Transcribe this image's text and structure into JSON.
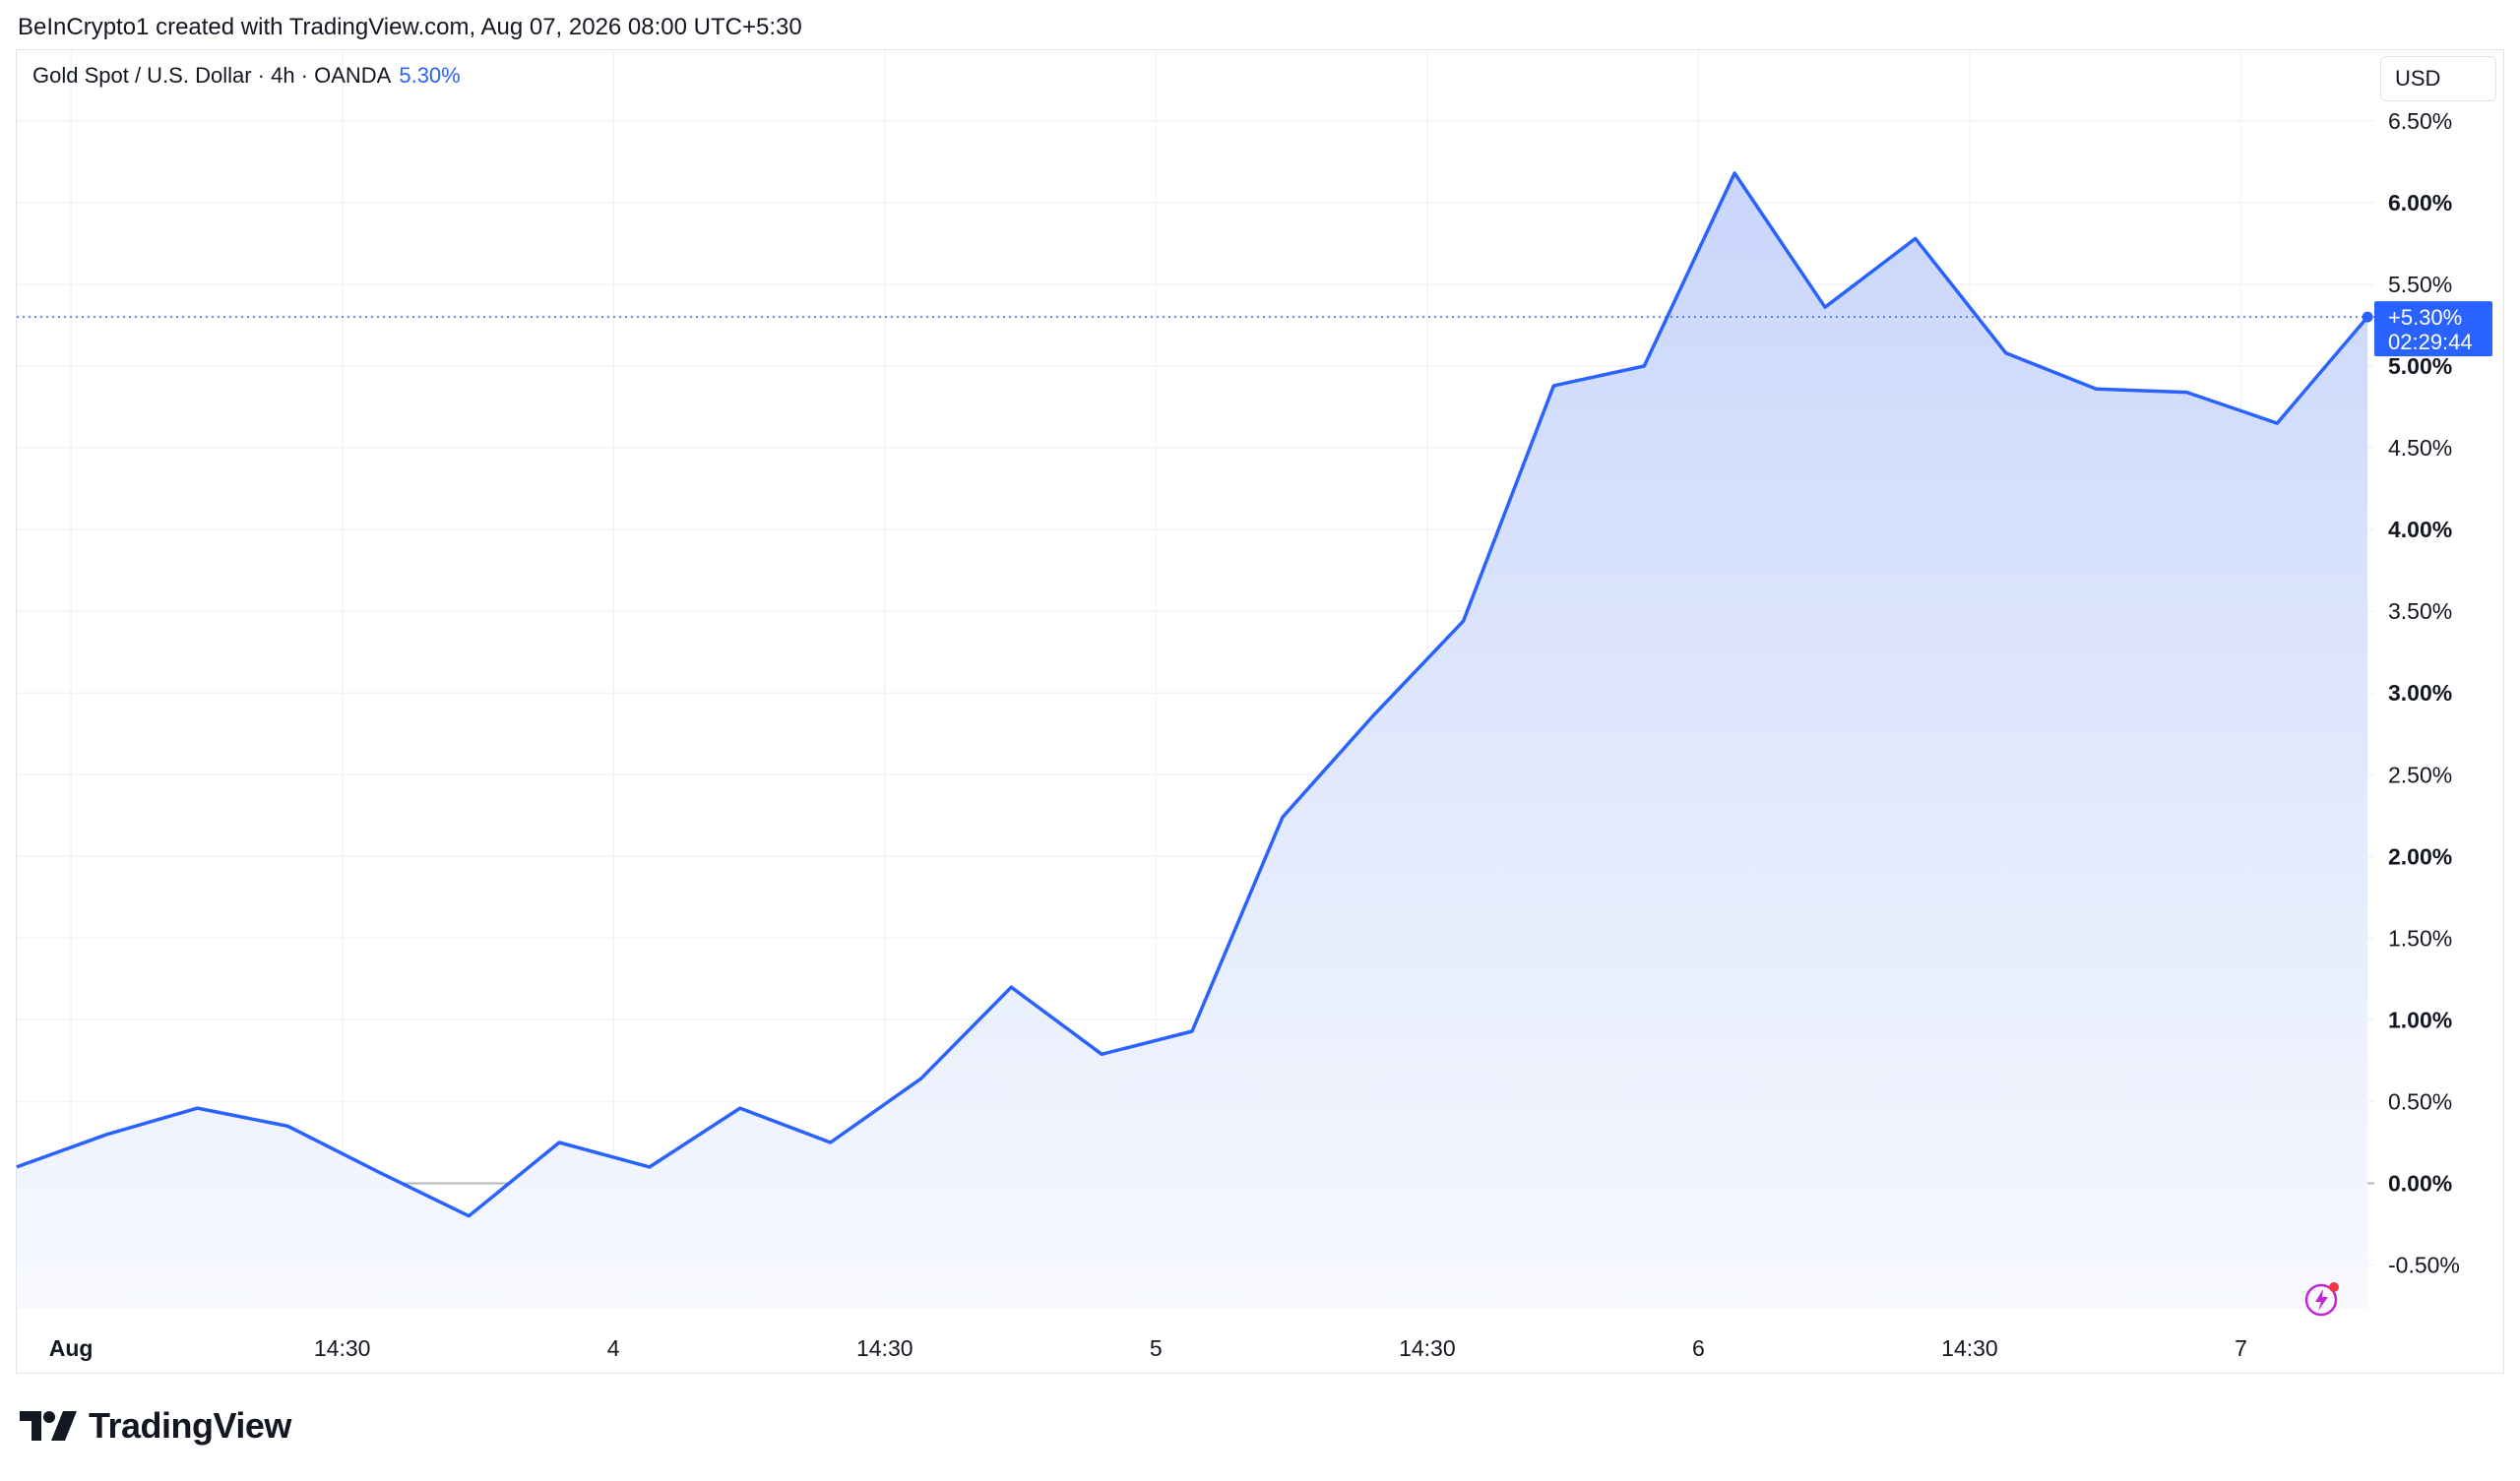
{
  "header": {
    "credit": "BeInCrypto1 created with TradingView.com, Aug 07, 2026 08:00 UTC+5:30"
  },
  "legend": {
    "symbol": "Gold Spot / U.S. Dollar · 4h · OANDA",
    "change": "5.30%"
  },
  "currency_button": {
    "label": "USD"
  },
  "price_tag": {
    "value": "+5.30%",
    "countdown": "02:29:44"
  },
  "brand": {
    "name": "TradingView"
  },
  "colors": {
    "line": "#2962ff",
    "fill_top": "#c9d6fb",
    "fill_bottom": "#f7f9fe",
    "grid": "#f0f3fa",
    "zero_line": "#b2b5be",
    "tag_bg": "#2962ff",
    "bolt": "#c026d3"
  },
  "icons": {
    "brand_logo": "tradingview-logo-icon",
    "bolt": "lightning-bolt-icon"
  },
  "chart_data": {
    "type": "area",
    "x": [
      0,
      1,
      2,
      3,
      4,
      5,
      6,
      7,
      8,
      9,
      10,
      11,
      12,
      13,
      14,
      15,
      16,
      17,
      18,
      19,
      20,
      21,
      22,
      23,
      24,
      25,
      26,
      27
    ],
    "y_unit": "%",
    "ylim": [
      -0.8,
      6.75
    ],
    "series": [
      {
        "values": [
          0.1,
          0.3,
          0.46,
          0.35,
          0.07,
          -0.2,
          0.25,
          0.1,
          0.46,
          0.25,
          0.64,
          1.2,
          0.79,
          0.93,
          2.24,
          2.86,
          3.44,
          4.88,
          5.0,
          6.18,
          5.36,
          5.78,
          5.08,
          4.86,
          4.84,
          4.65,
          5.3
        ]
      }
    ],
    "y_ticks": [
      "6.50%",
      "6.00%",
      "5.50%",
      "5.00%",
      "4.50%",
      "4.00%",
      "3.50%",
      "3.00%",
      "2.50%",
      "2.00%",
      "1.50%",
      "1.00%",
      "0.50%",
      "0.00%",
      "-0.50%"
    ],
    "y_tick_values": [
      6.5,
      6.0,
      5.5,
      5.0,
      4.5,
      4.0,
      3.5,
      3.0,
      2.5,
      2.0,
      1.5,
      1.0,
      0.5,
      0.0,
      -0.5
    ],
    "y_tick_bold": [
      false,
      true,
      false,
      true,
      false,
      true,
      false,
      true,
      false,
      true,
      false,
      true,
      false,
      true,
      false
    ],
    "x_ticks": [
      "Aug",
      "14:30",
      "4",
      "14:30",
      "5",
      "14:30",
      "6",
      "14:30",
      "7"
    ],
    "x_tick_bold": [
      true,
      false,
      false,
      false,
      false,
      false,
      false,
      false,
      false
    ],
    "x_tick_positions": [
      0.6,
      3.6,
      6.6,
      9.6,
      12.6,
      15.6,
      18.6,
      21.6,
      24.6
    ],
    "last_value": 5.3,
    "grid": true
  }
}
